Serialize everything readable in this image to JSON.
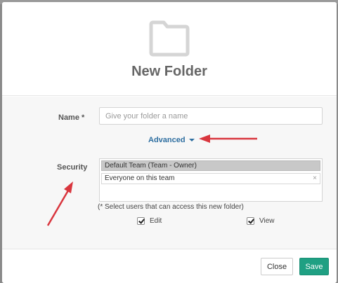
{
  "dialog": {
    "title": "New Folder",
    "icon": "folder-icon"
  },
  "form": {
    "name_label": "Name *",
    "name_placeholder": "Give your folder a name",
    "name_value": "",
    "advanced_label": "Advanced",
    "security_label": "Security",
    "security_options": [
      {
        "label": "Default Team (Team - Owner)",
        "selected": true
      },
      {
        "label": "Everyone on this team",
        "selected": false,
        "removable_glyph": "×"
      }
    ],
    "hint": "(* Select users that can access this new folder)",
    "permissions": [
      {
        "label": "Edit",
        "checked": true
      },
      {
        "label": "View",
        "checked": true
      }
    ]
  },
  "footer": {
    "close_label": "Close",
    "save_label": "Save"
  },
  "colors": {
    "save_button": "#1fa083",
    "link": "#2d6ea0",
    "annotation_arrow": "#d9363e"
  }
}
